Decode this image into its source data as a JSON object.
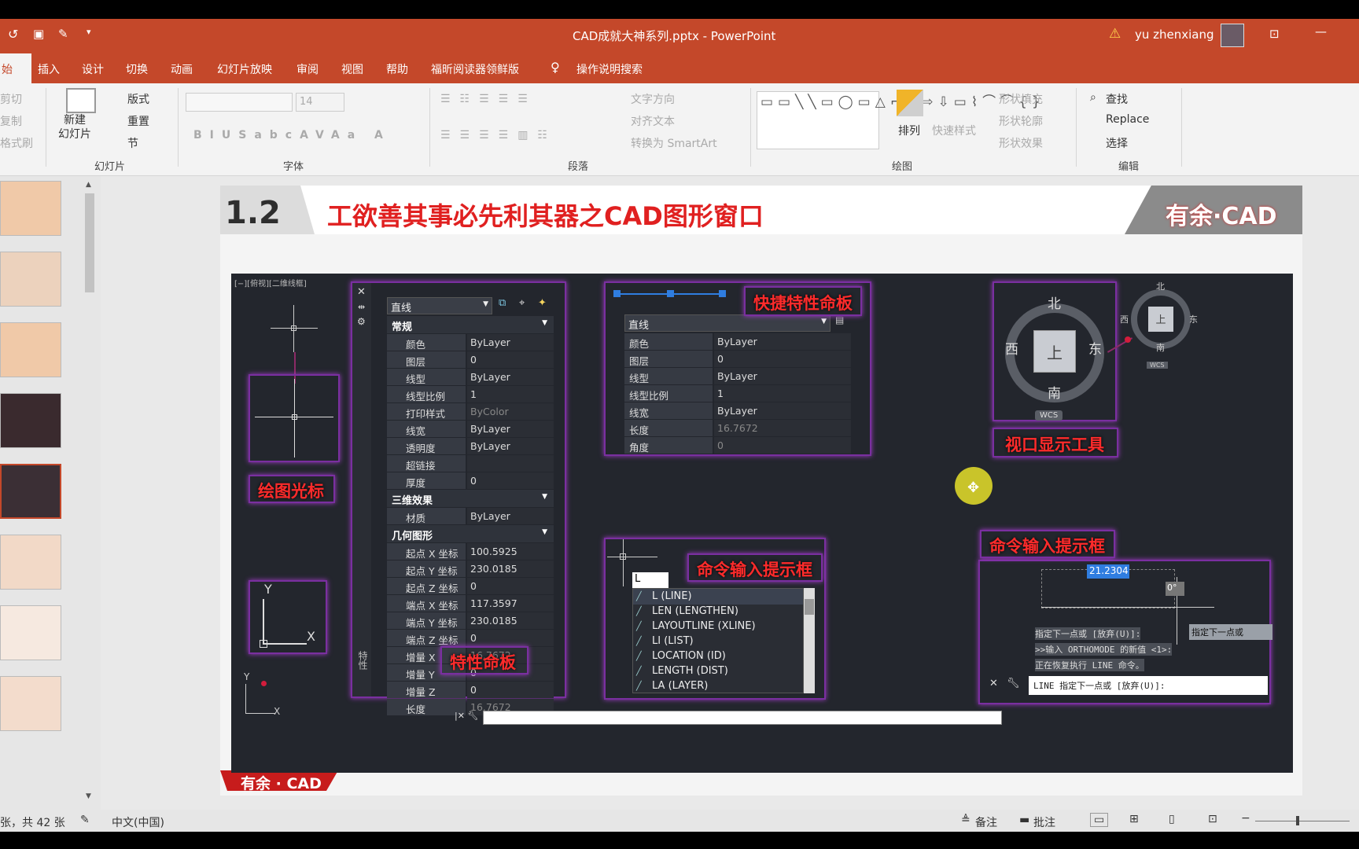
{
  "window": {
    "title": "CAD成就大神系列.pptx  -  PowerPoint",
    "user": "yu zhenxiang"
  },
  "tabs": [
    "插入",
    "设计",
    "切换",
    "动画",
    "幻灯片放映",
    "审阅",
    "视图",
    "帮助",
    "福昕阅读器领鲜版",
    "操作说明搜索"
  ],
  "tab_home": "始",
  "ribbon": {
    "clip": [
      "剪切",
      "复制",
      "格式刷"
    ],
    "new_slide": "新建\n幻灯片",
    "layout": "版式",
    "reset": "重置",
    "section": "节",
    "group_slides": "幻灯片",
    "font_size": "14",
    "group_font": "字体",
    "text_dir": "文字方向",
    "align_text": "对齐文本",
    "smartart": "转换为 SmartArt",
    "group_para": "段落",
    "arrange": "排列",
    "quick_styles": "快速样式",
    "shape_fill": "形状填充",
    "shape_outline": "形状轮廓",
    "shape_effect": "形状效果",
    "group_draw": "绘图",
    "find": "查找",
    "replace": "Replace",
    "select": "选择",
    "group_edit": "编辑"
  },
  "slide": {
    "num": "1.2",
    "title": "工欲善其事必先利其器之CAD图形窗口",
    "brand": "有余·CAD",
    "brand_bottom": "有余 · CAD",
    "vp_label": "[−][俯视][二维线框]",
    "labels": {
      "cursor": "绘图光标",
      "props": "特性命板",
      "quick": "快捷特性命板",
      "viewtool": "视口显示工具",
      "cmd1": "命令输入提示框",
      "cmd2": "命令输入提示框"
    },
    "prop_panel": {
      "type": "直线",
      "sections": [
        "常规",
        "三维效果",
        "几何图形"
      ],
      "general": [
        [
          "颜色",
          "ByLayer"
        ],
        [
          "图层",
          "0"
        ],
        [
          "线型",
          "ByLayer"
        ],
        [
          "线型比例",
          "1"
        ],
        [
          "打印样式",
          "ByColor"
        ],
        [
          "线宽",
          "ByLayer"
        ],
        [
          "透明度",
          "ByLayer"
        ],
        [
          "超链接",
          ""
        ],
        [
          "厚度",
          "0"
        ]
      ],
      "d3": [
        [
          "材质",
          "ByLayer"
        ]
      ],
      "geo": [
        [
          "起点 X 坐标",
          "100.5925"
        ],
        [
          "起点 Y 坐标",
          "230.0185"
        ],
        [
          "起点 Z 坐标",
          "0"
        ],
        [
          "端点 X 坐标",
          "117.3597"
        ],
        [
          "端点 Y 坐标",
          "230.0185"
        ],
        [
          "端点 Z 坐标",
          "0"
        ],
        [
          "增量 X",
          "16.7672"
        ],
        [
          "增量 Y",
          "0"
        ],
        [
          "增量 Z",
          "0"
        ],
        [
          "长度",
          "16.7672"
        ]
      ],
      "side": "特性"
    },
    "quick_panel": {
      "type": "直线",
      "rows": [
        [
          "颜色",
          "ByLayer"
        ],
        [
          "图层",
          "0"
        ],
        [
          "线型",
          "ByLayer"
        ],
        [
          "线型比例",
          "1"
        ],
        [
          "线宽",
          "ByLayer"
        ],
        [
          "长度",
          "16.7672"
        ],
        [
          "角度",
          "0"
        ]
      ]
    },
    "viewcube": {
      "n": "北",
      "s": "南",
      "w": "西",
      "e": "东",
      "top": "上",
      "wcs": "WCS"
    },
    "cmd_input": {
      "typed": "L",
      "items": [
        "L (LINE)",
        "LEN (LENGTHEN)",
        "LAYOUTLINE (XLINE)",
        "LI (LIST)",
        "LOCATION (ID)",
        "LENGTH (DIST)",
        "LA (LAYER)"
      ]
    },
    "dyn": {
      "value": "21.2304",
      "angle": "0°",
      "tip": "指定下一点或",
      "history": [
        "指定下一点或 [放弃(U)]:",
        ">>输入 ORTHOMODE 的新值 <1>:",
        "正在恢复执行 LINE 命令。"
      ],
      "cmdline": "LINE 指定下一点或 [放弃(U)]:"
    },
    "axis": {
      "x": "X",
      "y": "Y"
    }
  },
  "status": {
    "slide": "张，共 42 张",
    "lang": "中文(中国)",
    "notes": "备注",
    "comments": "批注"
  },
  "colors": {
    "accent": "#c4482a",
    "cad_bg": "#23262d",
    "highlight": "#7a2fa0",
    "label_red": "#ff2b2b"
  }
}
